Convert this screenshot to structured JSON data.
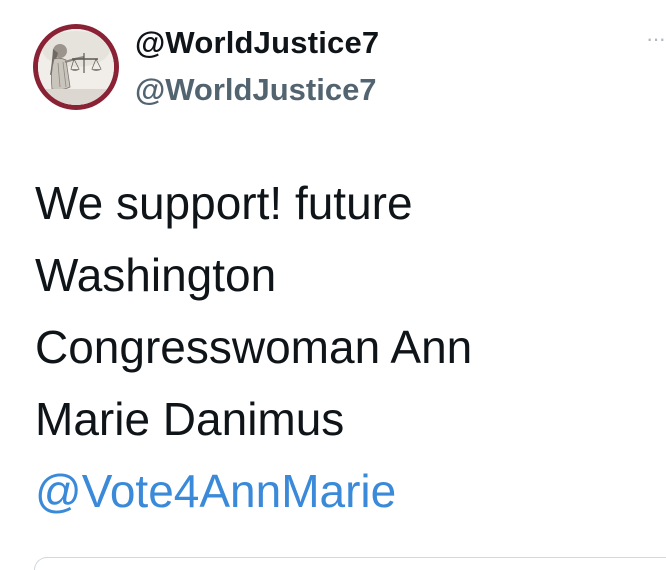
{
  "user": {
    "display_name": "@WorldJustice7",
    "handle": "@WorldJustice7",
    "avatar_icon": "lady-justice-icon",
    "avatar_ring_color": "#8a2236"
  },
  "more_menu": {
    "icon": "more-dots-icon",
    "glyph": "···"
  },
  "tweet": {
    "lines": [
      "We support! future",
      "Washington",
      "Congresswoman Ann",
      "Marie Danimus"
    ],
    "mention": "@Vote4AnnMarie",
    "mention_color": "#3a8ad9"
  }
}
